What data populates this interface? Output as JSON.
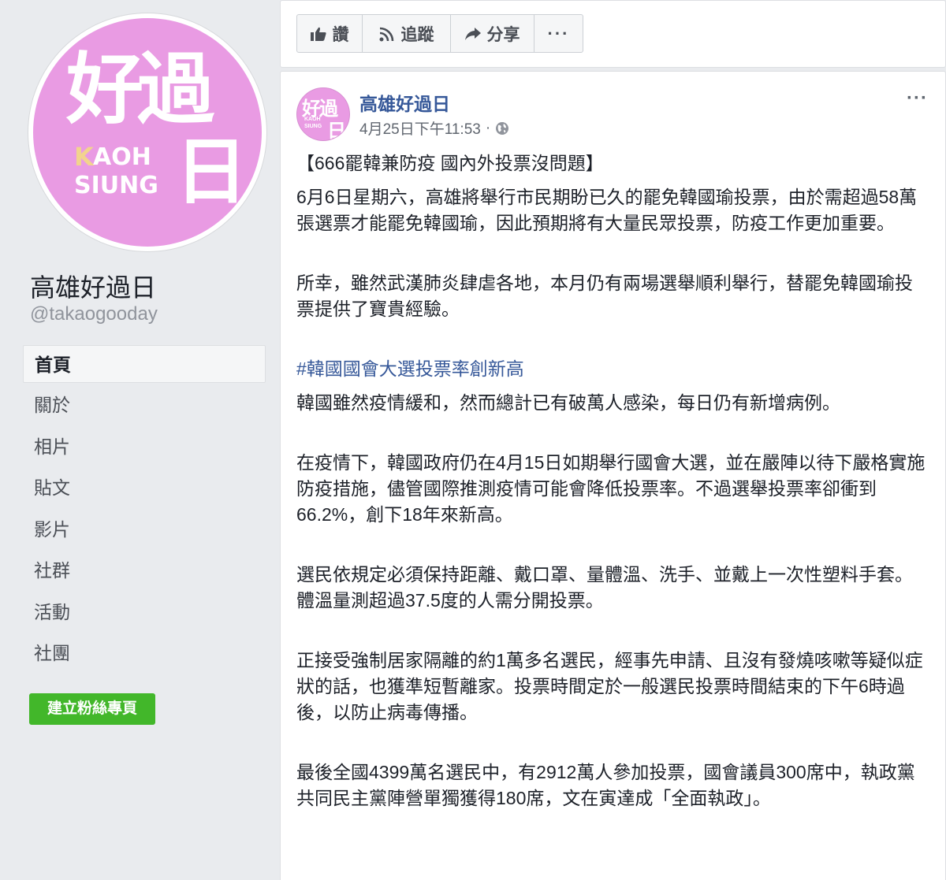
{
  "sidebar": {
    "logo": {
      "big_char_top": "好過",
      "big_char_bottom": "日",
      "letter_k": "K",
      "letters_aoh": "AOH",
      "letters_siung": "SIUNG",
      "bg_color": "#e99be3"
    },
    "page_name": "高雄好過日",
    "handle": "@takaogooday",
    "nav": [
      {
        "label": "首頁"
      },
      {
        "label": "關於"
      },
      {
        "label": "相片"
      },
      {
        "label": "貼文"
      },
      {
        "label": "影片"
      },
      {
        "label": "社群"
      },
      {
        "label": "活動"
      },
      {
        "label": "社團"
      }
    ],
    "create_button": "建立粉絲專頁"
  },
  "actions": {
    "like": "讚",
    "follow": "追蹤",
    "share": "分享",
    "more": "···"
  },
  "post": {
    "author": "高雄好過日",
    "timestamp": "4月25日下午11:53",
    "separator": "·",
    "menu": "···",
    "title": "【666罷韓兼防疫 國內外投票沒問題】",
    "paragraphs": [
      "6月6日星期六，高雄將舉行市民期盼已久的罷免韓國瑜投票，由於需超過58萬張選票才能罷免韓國瑜，因此預期將有大量民眾投票，防疫工作更加重要。",
      "所幸，雖然武漢肺炎肆虐各地，本月仍有兩場選舉順利舉行，替罷免韓國瑜投票提供了寶貴經驗。"
    ],
    "hashtag": "#韓國國會大選投票率創新高",
    "paragraphs2": [
      "韓國雖然疫情緩和，然而總計已有破萬人感染，每日仍有新增病例。",
      "在疫情下，韓國政府仍在4月15日如期舉行國會大選，並在嚴陣以待下嚴格實施防疫措施，儘管國際推測疫情可能會降低投票率。不過選舉投票率卻衝到66.2%，創下18年來新高。",
      "選民依規定必須保持距離、戴口罩、量體溫、洗手、並戴上一次性塑料手套。體溫量測超過37.5度的人需分開投票。",
      "正接受強制居家隔離的約1萬多名選民，經事先申請、且沒有發燒咳嗽等疑似症狀的話，也獲準短暫離家。投票時間定於一般選民投票時間結束的下午6時過後，以防止病毒傳播。",
      "最後全國4399萬名選民中，有2912萬人參加投票，國會議員300席中，執政黨共同民主黨陣營單獨獲得180席，文在寅達成「全面執政」。"
    ]
  }
}
